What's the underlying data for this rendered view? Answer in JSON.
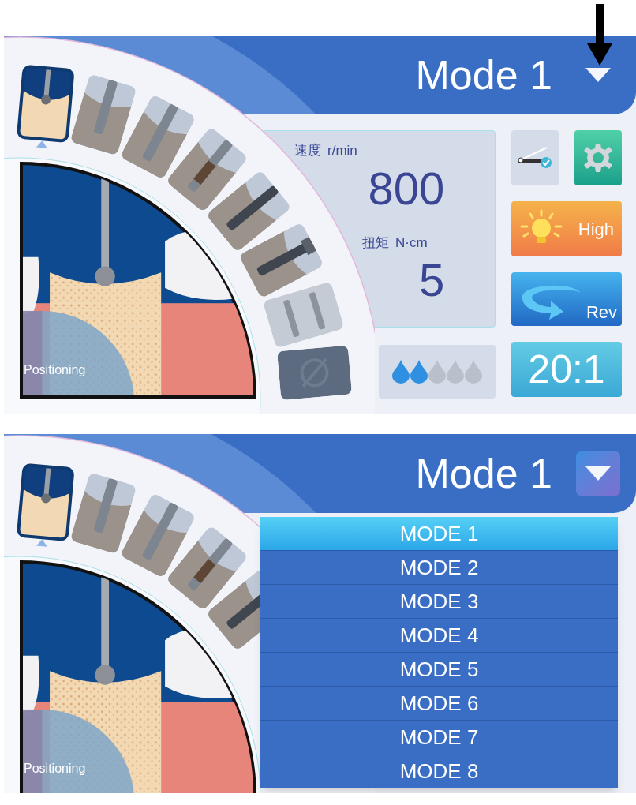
{
  "screens": [
    {
      "header": {
        "title": "Mode 1",
        "dropdown_open": false
      },
      "tools": [
        {
          "kind": "bur",
          "selected": true
        },
        {
          "kind": "pilot_drill",
          "selected": false
        },
        {
          "kind": "twist_drill",
          "selected": false
        },
        {
          "kind": "tap",
          "selected": false
        },
        {
          "kind": "implant",
          "selected": false
        },
        {
          "kind": "implant_mount",
          "selected": false
        },
        {
          "kind": "handpiece",
          "selected": false
        },
        {
          "kind": "disabled",
          "selected": false
        }
      ],
      "illustration": {
        "label": "Positioning"
      },
      "speed": {
        "label": "速度",
        "unit": "r/min",
        "value": "800"
      },
      "torque": {
        "label": "扭矩",
        "unit": "N·cm",
        "value": "5"
      },
      "water": {
        "stars": 2
      },
      "light": {
        "label": "High"
      },
      "direction": {
        "label": "Rev"
      },
      "ratio": "20:1"
    },
    {
      "header": {
        "title": "Mode 1",
        "dropdown_open": true
      },
      "tools": [
        {
          "kind": "bur",
          "selected": true
        },
        {
          "kind": "pilot_drill",
          "selected": false
        },
        {
          "kind": "twist_drill",
          "selected": false
        },
        {
          "kind": "tap",
          "selected": false
        },
        {
          "kind": "implant",
          "selected": false
        }
      ],
      "illustration": {
        "label": "Positioning"
      },
      "dropdown": {
        "options": [
          {
            "label": "MODE 1",
            "selected": true
          },
          {
            "label": "MODE 2",
            "selected": false
          },
          {
            "label": "MODE 3",
            "selected": false
          },
          {
            "label": "MODE 4",
            "selected": false
          },
          {
            "label": "MODE 5",
            "selected": false
          },
          {
            "label": "MODE 6",
            "selected": false
          },
          {
            "label": "MODE 7",
            "selected": false
          },
          {
            "label": "MODE 8",
            "selected": false
          }
        ]
      }
    }
  ]
}
